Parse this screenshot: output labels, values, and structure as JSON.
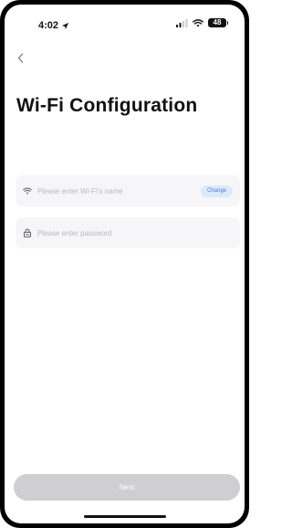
{
  "status_bar": {
    "time": "4:02",
    "battery": "48",
    "icons": [
      "location-arrow-icon",
      "signal-icon",
      "wifi-icon",
      "battery-icon"
    ]
  },
  "nav": {
    "back_icon": "chevron-left-icon"
  },
  "page": {
    "title": "Wi-Fi Configuration"
  },
  "wifi_field": {
    "icon": "wifi-icon",
    "value": "",
    "placeholder": "Please enter Wi-Fi's name",
    "change_label": "Change"
  },
  "password_field": {
    "icon": "lock-icon",
    "value": "",
    "placeholder": "Please enter password"
  },
  "next_button": {
    "label": "Next",
    "enabled": false
  },
  "colors": {
    "field_background": "#f6f6f8",
    "placeholder": "#b8b8bf",
    "change_bg": "#dde8fb",
    "change_text": "#4a7fe0",
    "next_disabled_bg": "#cfcfd3",
    "next_text": "#ffffff"
  }
}
